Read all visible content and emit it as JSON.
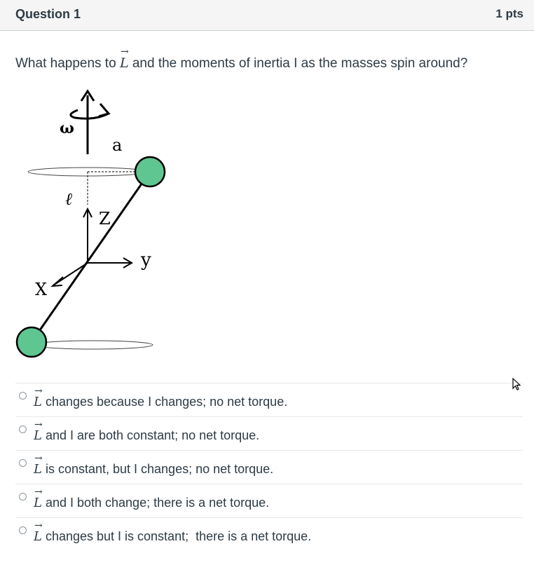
{
  "question": {
    "title": "Question 1",
    "points": "1 pts",
    "text_before": "What happens to ",
    "vector_symbol": "L",
    "text_after": " and the moments of inertia I as the masses spin around?"
  },
  "diagram": {
    "omega_label": "ω",
    "a_label": "a",
    "l_label": "ℓ",
    "z_label": "Z",
    "y_label": "y",
    "x_label": "X",
    "mass_color": "#5fc691"
  },
  "answers": [
    {
      "vector": "L",
      "text": " changes because I changes; no net torque."
    },
    {
      "vector": "L",
      "text": " and I are both constant; no net torque."
    },
    {
      "vector": "L",
      "text": " is constant, but I changes; no net torque."
    },
    {
      "vector": "L",
      "text": " and I both change; there is a net torque."
    },
    {
      "vector": "L",
      "text": " changes but I is constant;  there is a net torque."
    }
  ]
}
